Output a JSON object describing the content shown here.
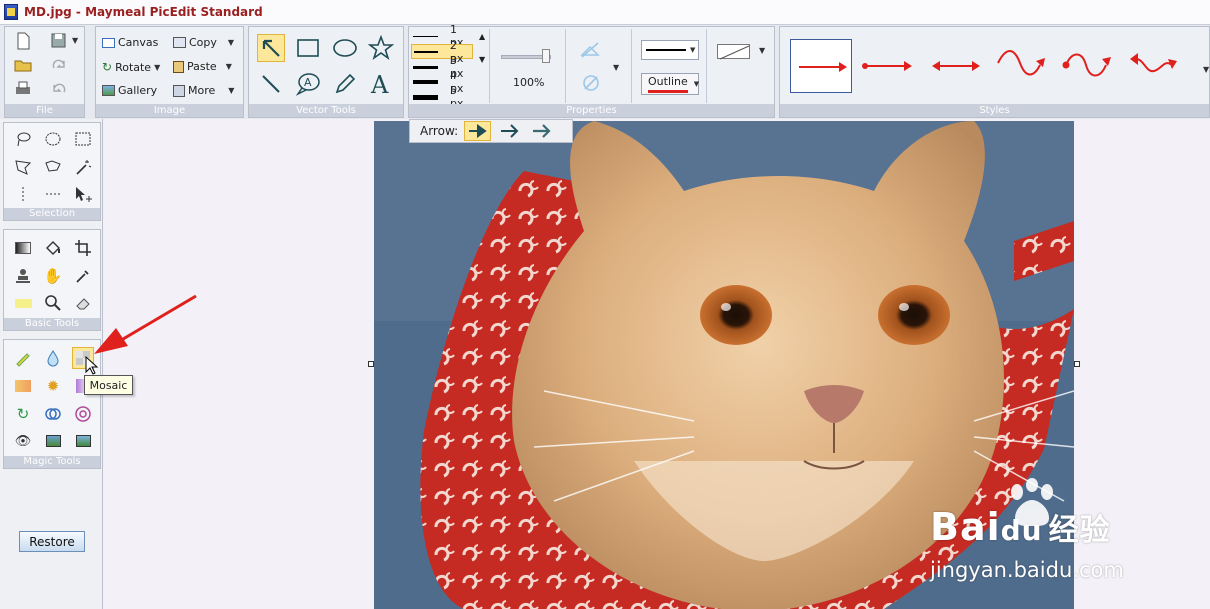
{
  "window": {
    "title": "MD.jpg - Maymeal PicEdit Standard"
  },
  "ribbon": {
    "file": {
      "label": "File"
    },
    "image": {
      "label": "Image",
      "canvas": "Canvas",
      "copy": "Copy",
      "rotate": "Rotate",
      "paste": "Paste",
      "gallery": "Gallery",
      "more": "More"
    },
    "vector": {
      "label": "Vector Tools"
    },
    "properties": {
      "label": "Properties",
      "widths": [
        "1 px",
        "2 px",
        "3 px",
        "4 px",
        "5 px"
      ],
      "selected_width": "2 px",
      "opacity": "100%",
      "outline": "Outline"
    },
    "styles": {
      "label": "Styles"
    }
  },
  "arrowbar": {
    "label": "Arrow:"
  },
  "left": {
    "selection": {
      "label": "Selection"
    },
    "basic": {
      "label": "Basic Tools"
    },
    "magic": {
      "label": "Magic Tools"
    },
    "restore": "Restore"
  },
  "tooltip": {
    "text": "Mosaic"
  },
  "watermark": {
    "brand_a": "Bai",
    "brand_b": "du",
    "brand_cn": "经验",
    "site": "jingyan.baidu.com"
  },
  "colors": {
    "accent_red": "#e0201c",
    "title_red": "#9a1f1f",
    "selected": "#fde79a",
    "group_label": "#c9cfdb"
  }
}
